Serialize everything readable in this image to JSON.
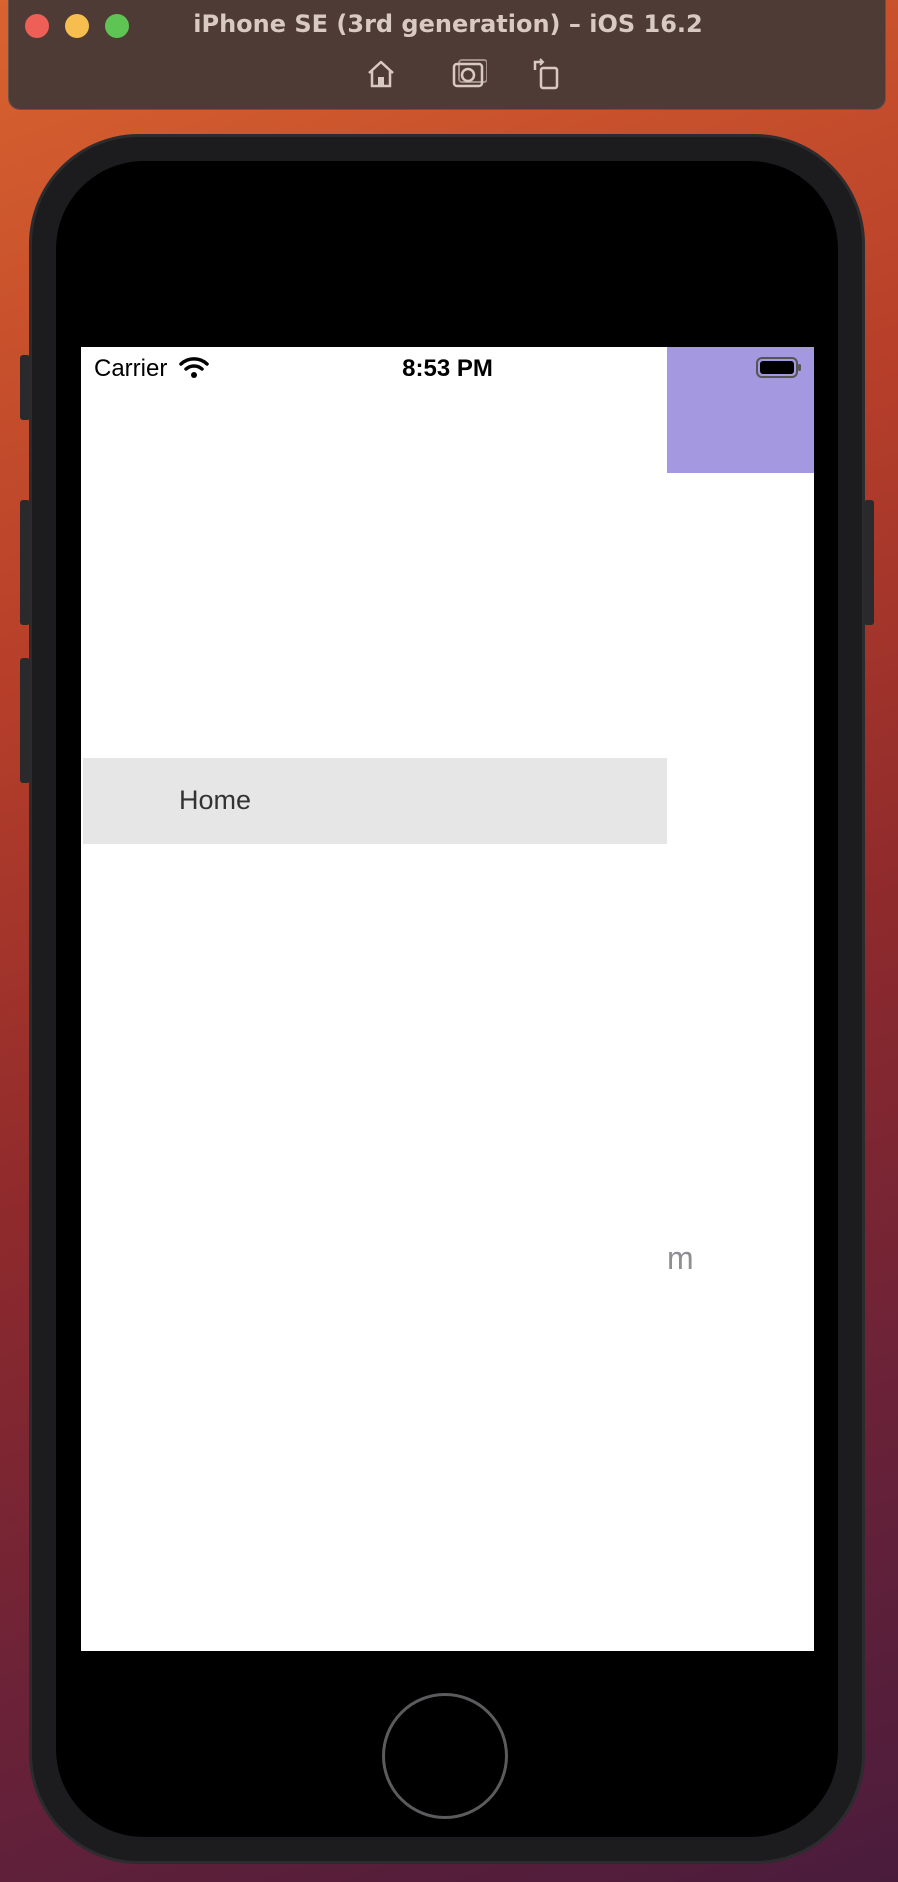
{
  "window": {
    "title": "iPhone SE (3rd generation) – iOS 16.2",
    "toolbar_icons": [
      "home-icon",
      "screenshot-icon",
      "rotate-icon"
    ]
  },
  "status_bar": {
    "carrier": "Carrier",
    "time": "8:53 PM"
  },
  "menu": {
    "items": [
      {
        "label": "Home"
      }
    ]
  },
  "content": {
    "partial_text": "m"
  },
  "colors": {
    "accent_panel": "#a499e0",
    "menu_item_bg": "#e6e6e6"
  }
}
